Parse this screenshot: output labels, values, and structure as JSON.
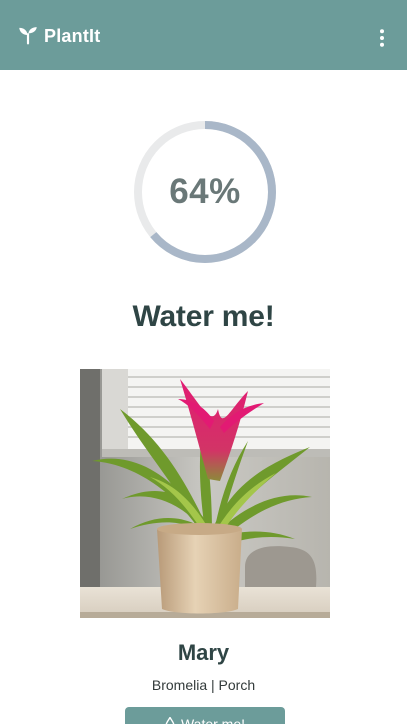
{
  "app": {
    "name": "PlantIt",
    "icons": {
      "logo": "sprout-icon",
      "menu": "more-vertical-icon",
      "water": "water-drop-icon"
    },
    "colors": {
      "header": "#6c9c9a",
      "ring_fill": "#a9b7c8",
      "ring_track": "#e9eaeb",
      "title": "#2f4545"
    }
  },
  "status": {
    "percent": 64,
    "percent_label": "64%",
    "title": "Water me!"
  },
  "plant": {
    "name": "Mary",
    "meta": "Bromelia | Porch",
    "photo_subject": "Bromeliad in a wooden pot by a window"
  },
  "actions": {
    "water_label": "Water me!"
  }
}
